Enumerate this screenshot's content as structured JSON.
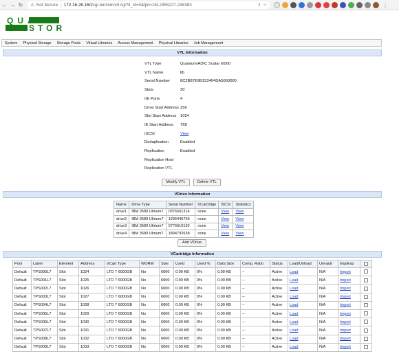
{
  "browser": {
    "security_label": "Not Secure",
    "url_host": "172.16.26.160",
    "url_path": "/cgi-bin/indvvtl.cgi?tl_id=0&tjid=1612455227.248383"
  },
  "logo": {
    "line1": "QUAD",
    "line2": "STOR",
    "color": "#1a7a1a"
  },
  "menu": [
    "System",
    "Physical Storage",
    "Storage Pools",
    "Virtual Libraries",
    "Access Management",
    "Physical Libraries",
    "Job Management"
  ],
  "vtl_info": {
    "title": "VTL Information",
    "rows": [
      {
        "label": "VTL Type",
        "value": "Quantum/ADIC Scalar i6000"
      },
      {
        "label": "VTL Name",
        "value": "lib"
      },
      {
        "label": "Serial Number",
        "value": "8C2B87E9B153404DA5060000"
      },
      {
        "label": "Slots",
        "value": "20"
      },
      {
        "label": "I/E Ports",
        "value": "4"
      },
      {
        "label": "Drive Start Address",
        "value": "256"
      },
      {
        "label": "Slot Start Address",
        "value": "1024"
      },
      {
        "label": "IE Start Address",
        "value": "768"
      },
      {
        "label": "iSCSI",
        "value": "View"
      },
      {
        "label": "Deduplication",
        "value": "Enabled"
      },
      {
        "label": "Replication",
        "value": "Enabled"
      },
      {
        "label": "Replication Host",
        "value": ""
      },
      {
        "label": "Replication VTL",
        "value": ""
      }
    ],
    "modify_button": "Modify VTL",
    "delete_button": "Delete VTL"
  },
  "vdrive": {
    "title": "VDrive Information",
    "headers": [
      "Name",
      "Drive Type",
      "Serial Number",
      "VCartridge",
      "iSCSI",
      "Statistics"
    ],
    "rows": [
      [
        "drive1",
        "IBM 3580 Ultrium7",
        "0376501314",
        "none",
        "View",
        "View"
      ],
      [
        "drive2",
        "IBM 3580 Ultrium7",
        "1296445756",
        "none",
        "View",
        "View"
      ],
      [
        "drive3",
        "IBM 3580 Ultrium7",
        "0776610192",
        "none",
        "View",
        "View"
      ],
      [
        "drive4",
        "IBM 3580 Ultrium7",
        "1894792638",
        "none",
        "View",
        "View"
      ]
    ],
    "add_button": "Add VDrive"
  },
  "vcart": {
    "title": "VCartridge Information",
    "headers": [
      "Pool",
      "Label",
      "Element",
      "Address",
      "VCart Type",
      "WORM",
      "Size",
      "Used",
      "Used %",
      "Data Size",
      "Comp. Ratio",
      "Status",
      "Load/Unload",
      "Unvault",
      "Imp/Exp",
      ""
    ],
    "rows": [
      [
        "Default",
        "TPS000L7",
        "Slot",
        "1024",
        "LTO 7 6000GB",
        "No",
        "6000",
        "0.00 KB",
        "0%",
        "0.00 KB",
        "--",
        "Active",
        "Load",
        "N/A",
        "Import"
      ],
      [
        "Default",
        "TPS001L7",
        "Slot",
        "1025",
        "LTO 7 6000GB",
        "No",
        "6000",
        "0.00 KB",
        "0%",
        "0.00 KB",
        "--",
        "Active",
        "Load",
        "N/A",
        "Import"
      ],
      [
        "Default",
        "TPS002L7",
        "Slot",
        "1026",
        "LTO 7 6000GB",
        "No",
        "6000",
        "0.00 KB",
        "0%",
        "0.00 KB",
        "--",
        "Active",
        "Load",
        "N/A",
        "Import"
      ],
      [
        "Default",
        "TPS003L7",
        "Slot",
        "1027",
        "LTO 7 6000GB",
        "No",
        "6000",
        "0.00 KB",
        "0%",
        "0.00 KB",
        "--",
        "Active",
        "Load",
        "N/A",
        "Import"
      ],
      [
        "Default",
        "TPS004L7",
        "Slot",
        "1028",
        "LTO 7 6000GB",
        "No",
        "6000",
        "0.00 KB",
        "0%",
        "0.00 KB",
        "--",
        "Active",
        "Load",
        "N/A",
        "Import"
      ],
      [
        "Default",
        "TPS005L7",
        "Slot",
        "1029",
        "LTO 7 6000GB",
        "No",
        "6000",
        "0.00 KB",
        "0%",
        "0.00 KB",
        "--",
        "Active",
        "Load",
        "N/A",
        "Import"
      ],
      [
        "Default",
        "TPS006L7",
        "Slot",
        "1030",
        "LTO 7 6000GB",
        "No",
        "6000",
        "0.00 KB",
        "0%",
        "0.00 KB",
        "--",
        "Active",
        "Load",
        "N/A",
        "Import"
      ],
      [
        "Default",
        "TPS007L7",
        "Slot",
        "1031",
        "LTO 7 6000GB",
        "No",
        "6000",
        "0.00 KB",
        "0%",
        "0.00 KB",
        "--",
        "Active",
        "Load",
        "N/A",
        "Import"
      ],
      [
        "Default",
        "TPS008L7",
        "Slot",
        "1032",
        "LTO 7 6000GB",
        "No",
        "6000",
        "0.00 KB",
        "0%",
        "0.00 KB",
        "--",
        "Active",
        "Load",
        "N/A",
        "Import"
      ],
      [
        "Default",
        "TPS009L7",
        "Slot",
        "1033",
        "LTO 7 6000GB",
        "No",
        "6000",
        "0.00 KB",
        "0%",
        "0.00 KB",
        "--",
        "Active",
        "Load",
        "N/A",
        "Import"
      ]
    ]
  },
  "colors": {
    "link": "#1a3fbf",
    "section_bar": "#dbe7f7"
  }
}
